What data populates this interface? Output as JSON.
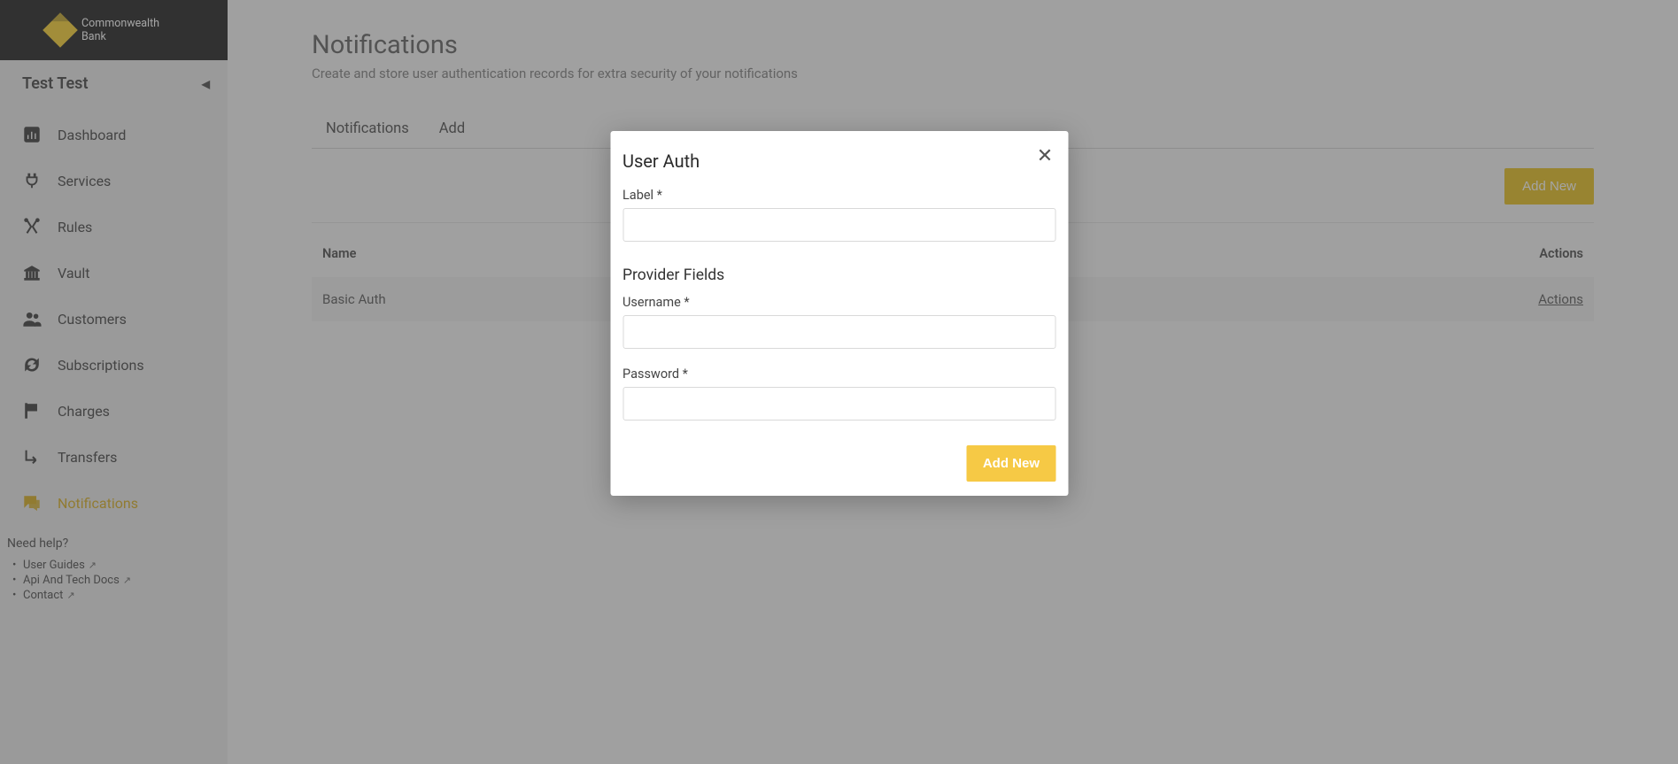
{
  "brand": {
    "name_line1": "Commonwealth",
    "name_line2": "Bank"
  },
  "org": {
    "name": "Test Test"
  },
  "nav": {
    "dashboard": "Dashboard",
    "services": "Services",
    "rules": "Rules",
    "vault": "Vault",
    "customers": "Customers",
    "subscriptions": "Subscriptions",
    "charges": "Charges",
    "transfers": "Transfers",
    "notifications": "Notifications"
  },
  "help": {
    "title": "Need help?",
    "links": {
      "user_guides": "User Guides",
      "api_docs": "Api And Tech Docs",
      "contact": "Contact"
    }
  },
  "page": {
    "title": "Notifications",
    "subtitle": "Create and store user authentication records for extra security of your notifications"
  },
  "tabs": {
    "notifications": "Notifications",
    "add": "Add"
  },
  "buttons": {
    "add_new": "Add New"
  },
  "table": {
    "headers": {
      "name": "Name",
      "actions": "Actions"
    },
    "rows": [
      {
        "name": "Basic Auth",
        "action": "Actions"
      }
    ]
  },
  "modal": {
    "title": "User Auth",
    "labels": {
      "label": "Label *",
      "provider_fields": "Provider Fields",
      "username": "Username *",
      "password": "Password *"
    },
    "submit": "Add New"
  }
}
